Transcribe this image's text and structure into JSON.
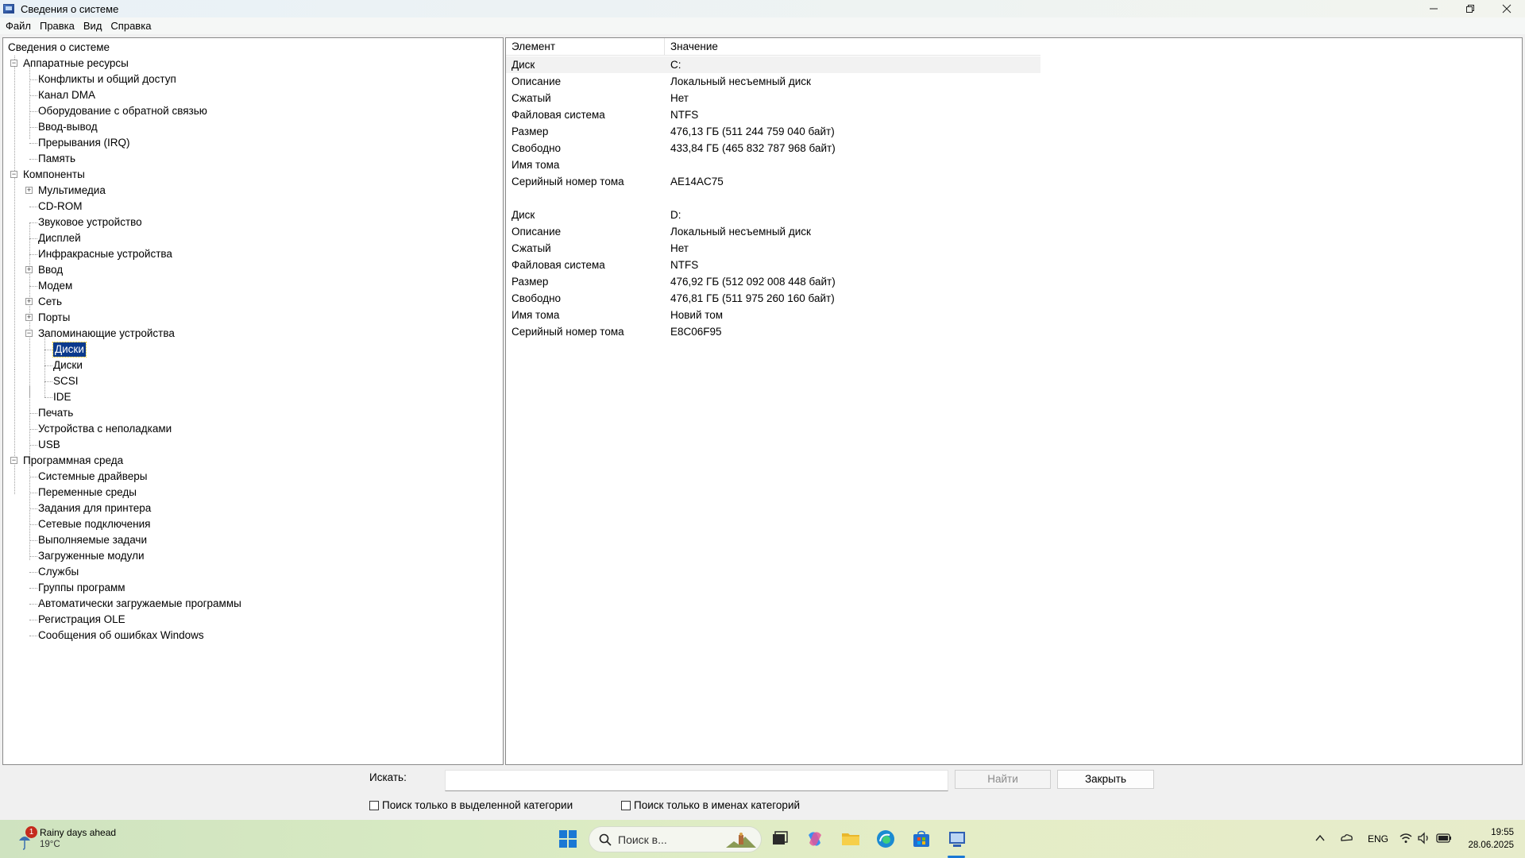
{
  "window": {
    "title": "Сведения о системе"
  },
  "menu": [
    "Файл",
    "Правка",
    "Вид",
    "Справка"
  ],
  "tree": {
    "root": "Сведения о системе",
    "hardware": {
      "label": "Аппаратные ресурсы",
      "children": [
        "Конфликты и общий доступ",
        "Канал DMA",
        "Оборудование с обратной связью",
        "Ввод-вывод",
        "Прерывания (IRQ)",
        "Память"
      ]
    },
    "components": {
      "label": "Компоненты",
      "children": [
        "Мультимедиа",
        "CD-ROM",
        "Звуковое устройство",
        "Дисплей",
        "Инфракрасные устройства",
        "Ввод",
        "Модем",
        "Сеть",
        "Порты",
        "Запоминающие устройства"
      ],
      "storage_children": [
        "Диски",
        "Диски",
        "SCSI",
        "IDE"
      ],
      "after": [
        "Печать",
        "Устройства с неполадками",
        "USB"
      ]
    },
    "software": {
      "label": "Программная среда",
      "children": [
        "Системные драйверы",
        "Переменные среды",
        "Задания для принтера",
        "Сетевые подключения",
        "Выполняемые задачи",
        "Загруженные модули",
        "Службы",
        "Группы программ",
        "Автоматически загружаемые программы",
        "Регистрация OLE",
        "Сообщения об ошибках Windows"
      ]
    }
  },
  "details": {
    "col_item": "Элемент",
    "col_value": "Значение",
    "rows": [
      {
        "item": "Диск",
        "value": "C:"
      },
      {
        "item": "Описание",
        "value": "Локальный несъемный диск"
      },
      {
        "item": "Сжатый",
        "value": "Нет"
      },
      {
        "item": "Файловая система",
        "value": "NTFS"
      },
      {
        "item": "Размер",
        "value": "476,13 ГБ (511 244 759 040 байт)"
      },
      {
        "item": "Свободно",
        "value": "433,84 ГБ (465 832 787 968 байт)"
      },
      {
        "item": "Имя тома",
        "value": ""
      },
      {
        "item": "Серийный номер тома",
        "value": "AE14AC75"
      },
      {
        "item": "",
        "value": ""
      },
      {
        "item": "Диск",
        "value": "D:"
      },
      {
        "item": "Описание",
        "value": "Локальный несъемный диск"
      },
      {
        "item": "Сжатый",
        "value": "Нет"
      },
      {
        "item": "Файловая система",
        "value": "NTFS"
      },
      {
        "item": "Размер",
        "value": "476,92 ГБ (512 092 008 448 байт)"
      },
      {
        "item": "Свободно",
        "value": "476,81 ГБ (511 975 260 160 байт)"
      },
      {
        "item": "Имя тома",
        "value": "Новий том"
      },
      {
        "item": "Серийный номер тома",
        "value": "E8C06F95"
      }
    ]
  },
  "search": {
    "label": "Искать:",
    "value": "",
    "find_button": "Найти",
    "close_button": "Закрыть",
    "check_selected": "Поиск только в выделенной категории",
    "check_names": "Поиск только в именах категорий"
  },
  "taskbar": {
    "weather_title": "Rainy days ahead",
    "weather_temp": "19°C",
    "weather_badge": "1",
    "search_placeholder": "Поиск в...",
    "lang": "ENG",
    "time": "19:55",
    "date": "28.06.2025"
  },
  "colors": {
    "selection": "#0b3a8c",
    "start": "#1a78d4"
  }
}
